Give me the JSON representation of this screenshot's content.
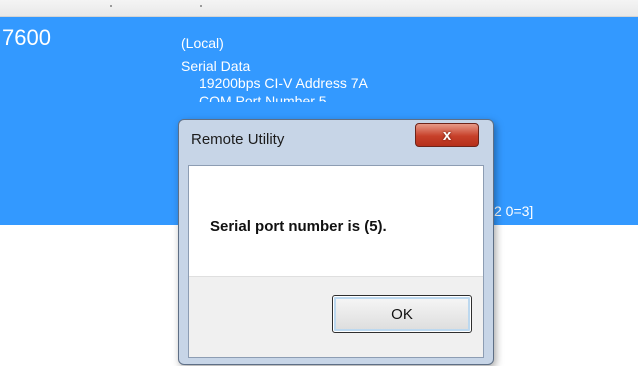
{
  "list_row": {
    "model": "7600",
    "source": "(Local)",
    "line_serial": "Serial Data",
    "line_settings": "19200bps  CI-V Address 7A",
    "line_com_partial": "COM Port Number 5",
    "row_tail": "2 0=3]"
  },
  "dialog": {
    "title": "Remote Utility",
    "close_glyph": "x",
    "message": "Serial port number is (5).",
    "ok_label": "OK"
  },
  "colors": {
    "selection": "#3399ff",
    "close_button": "#c7402a",
    "dialog_frame": "#c7d5e7"
  }
}
